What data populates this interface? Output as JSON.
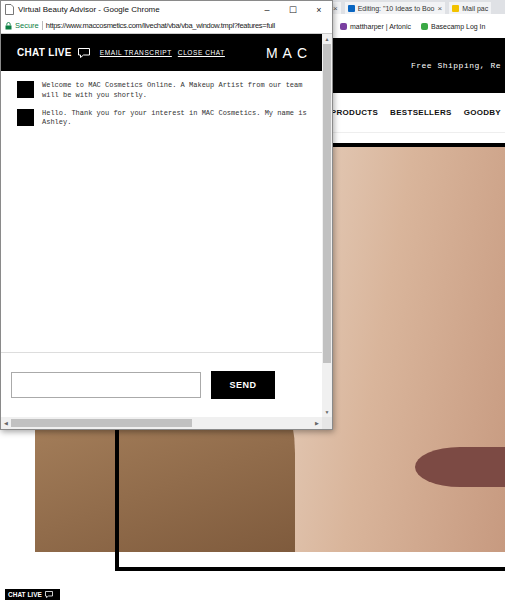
{
  "browser": {
    "tabs": [
      {
        "label": "",
        "close": "×",
        "color": "",
        "selected": false
      },
      {
        "label": "Editing: \"10 Ideas to Boo",
        "close": "×",
        "color": "#0a66c2",
        "selected": false
      },
      {
        "label": "Mail pac",
        "close": "",
        "color": "#f2c200",
        "selected": false
      }
    ],
    "bookmarks": [
      {
        "label": "mattharper | Artonic",
        "color": "#7a3fa0"
      },
      {
        "label": "Basecamp Log In",
        "color": "#3aa845"
      }
    ]
  },
  "site": {
    "promo": "Free Shipping, Re",
    "nav": [
      "PRODUCTS",
      "BESTSELLERS",
      "GOODBY"
    ],
    "chat_button": "CHAT LIVE"
  },
  "popup": {
    "title": "Virtual Beauty Advisor - Google Chrome",
    "controls": [
      "–",
      "☐",
      "×"
    ],
    "security": "Secure",
    "url": "https://www.maccosmetics.com/livechat/vba/vba_window.tmpl?features=full",
    "header": {
      "chat_live": "CHAT LIVE",
      "email_transcript": "EMAIL TRANSCRIPT",
      "close_chat": "CLOSE CHAT",
      "logo": "MAC"
    },
    "messages": [
      "Welcome to MAC Cosmetics Online. A Makeup Artist from our team will be with you shortly.",
      "Hello. Thank you for your interest in MAC Cosmetics. My name is Ashley."
    ],
    "input": {
      "placeholder": ""
    },
    "send": "SEND",
    "scrollbars": {
      "up": "▲",
      "down": "▼",
      "left": "◀",
      "right": "▶",
      "vertical_level": 0.88,
      "horizontal_level": 0.6
    }
  }
}
